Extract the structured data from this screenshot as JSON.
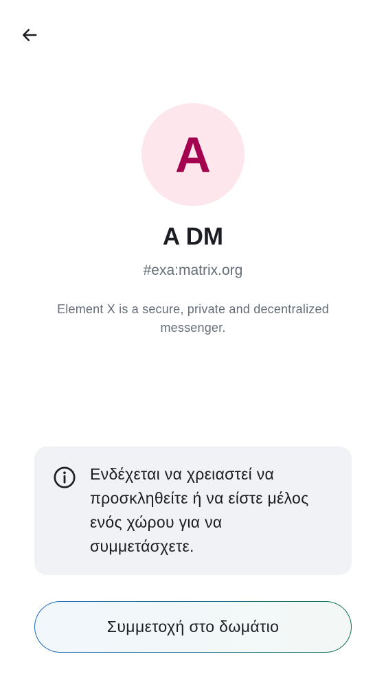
{
  "header": {
    "back_icon": "arrow-left-icon"
  },
  "room": {
    "avatar_letter": "A",
    "avatar_bg": "#fde6ec",
    "avatar_fg": "#a3004f",
    "name": "A DM",
    "alias": "#exa:matrix.org",
    "description": "Element X is a secure, private and decentralized messenger."
  },
  "notice": {
    "icon": "info-icon",
    "text": "Ενδέχεται να χρειαστεί να προσκληθείτε ή να είστε μέλος ενός χώρου για να συμμετάσχετε."
  },
  "actions": {
    "join_label": "Συμμετοχή στο δωμάτιο"
  }
}
